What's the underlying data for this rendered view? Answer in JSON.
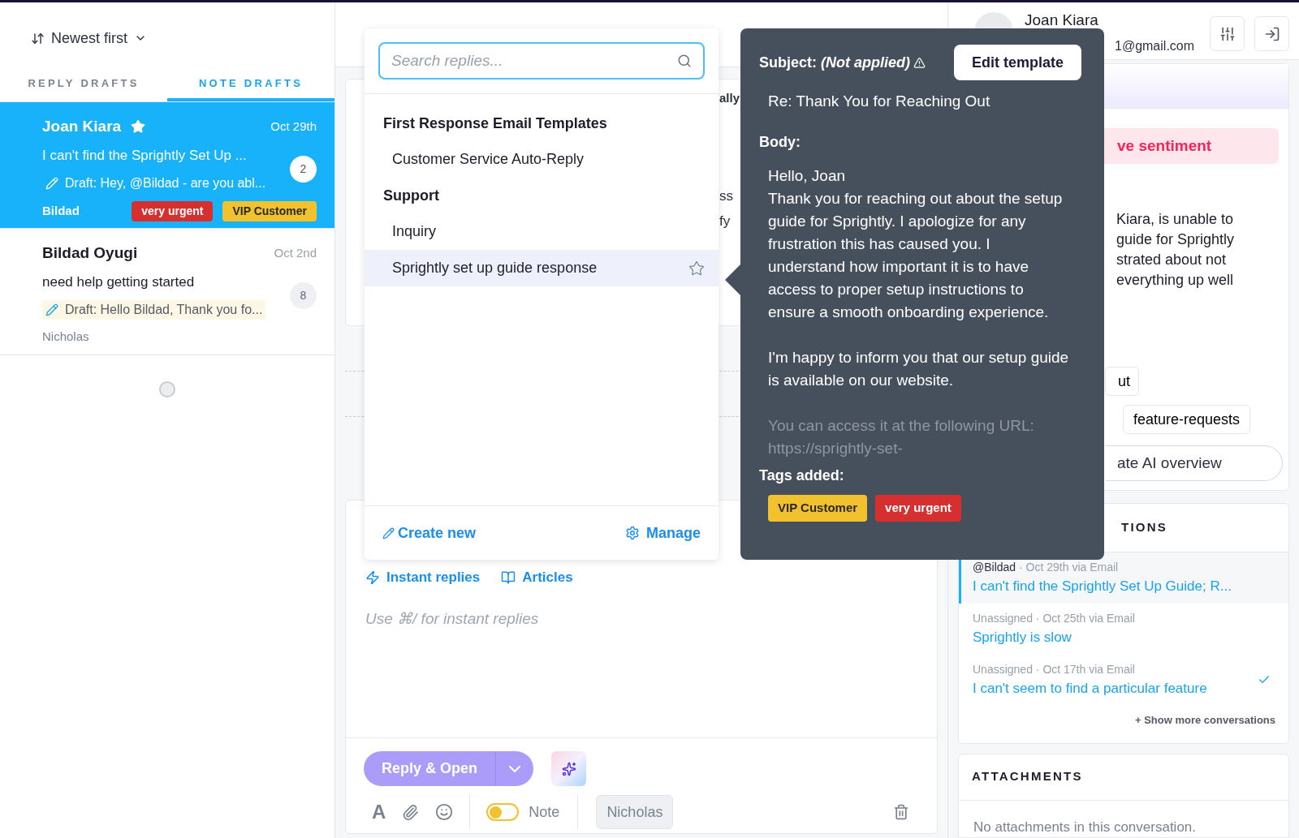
{
  "sort": {
    "label": "Newest first"
  },
  "draft_tabs": [
    {
      "label": "REPLY DRAFTS",
      "selected": false
    },
    {
      "label": "NOTE DRAFTS",
      "selected": true
    }
  ],
  "conversations": [
    {
      "name": "Joan Kiara",
      "starred": true,
      "date": "Oct 29th",
      "subject": "I can't find the Sprightly Set Up ...",
      "draft": "Draft: Hey, @Bildad - are you abl...",
      "count": "2",
      "assignee": "Bildad",
      "selected": true,
      "tags": [
        {
          "label": "very urgent",
          "color": "#d62f2f"
        },
        {
          "label": "VIP Customer",
          "color": "#f2c12e"
        }
      ]
    },
    {
      "name": "Bildad Oyugi",
      "starred": false,
      "date": "Oct 2nd",
      "subject": "need help getting started",
      "draft": "Draft: Hello Bildad, Thank you fo...",
      "count": "8",
      "assignee": "Nicholas",
      "selected": false
    }
  ],
  "thread_peek": [
    "ally",
    "ss",
    "fy"
  ],
  "composer": {
    "links": [
      {
        "kind": "bolt",
        "label": "Instant replies"
      },
      {
        "kind": "book",
        "label": "Articles"
      }
    ],
    "placeholder": "Use ⌘/ for instant replies",
    "send_button": "Reply & Open",
    "format_glyph": "A",
    "note_toggle": {
      "label": "Note",
      "on": false
    },
    "assignee": "Nicholas"
  },
  "replies_dropdown": {
    "placeholder": "Search replies...",
    "groups": [
      {
        "title": "First Response Email Templates",
        "items": [
          {
            "label": "Customer Service Auto-Reply",
            "selected": false,
            "starred": false
          }
        ]
      },
      {
        "title": "Support",
        "items": [
          {
            "label": "Inquiry",
            "selected": false,
            "starred": false
          },
          {
            "label": "Sprightly set up guide response",
            "selected": true,
            "starred": false
          }
        ]
      }
    ],
    "create_label": "Create new",
    "manage_label": "Manage"
  },
  "template_preview": {
    "subject_label": "Subject:",
    "subject_note": "(Not applied)",
    "edit_button": "Edit template",
    "subject": "Re: Thank You for Reaching Out",
    "body_label": "Body:",
    "body_paragraphs": [
      {
        "text": "Hello, Joan\nThank you for reaching out about the setup guide for Sprightly. I apologize for any frustration this has caused you. I understand how important it is to have access to proper setup instructions to ensure a smooth onboarding experience.",
        "faded": false
      },
      {
        "text": "I'm happy to inform you that our setup guide is available on our website.",
        "faded": false
      },
      {
        "text": "You can access it at the following URL:\nhttps://sprightly-set-",
        "faded": true
      }
    ],
    "tags_label": "Tags added:",
    "tags": [
      {
        "label": "VIP Customer",
        "color": "#f2c12e"
      },
      {
        "label": "very urgent",
        "color": "#d62f2f"
      }
    ]
  },
  "contact": {
    "name": "Joan Kiara",
    "email_fragment": "1@gmail.com",
    "sentiment_fragment": "ve sentiment",
    "summary_fragments": [
      "Kiara, is unable to",
      "guide for Sprightly",
      "strated about not",
      "everything up well"
    ],
    "topic_fragments": [
      "ut",
      "feature-requests"
    ],
    "ai_button_fragment": "ate AI overview"
  },
  "recent_conversations": {
    "heading_fragment": "TIONS",
    "items": [
      {
        "author": "@Bildad",
        "meta": "· Oct 29th via Email",
        "title": "I can't find the Sprightly Set Up Guide; R...",
        "selected": true,
        "resolved": false
      },
      {
        "author": "Unassigned",
        "meta": "· Oct 25th via Email",
        "title": "Sprightly is slow",
        "selected": false,
        "resolved": false
      },
      {
        "author": "Unassigned",
        "meta": "· Oct 17th via Email",
        "title": "I can't seem to find a particular feature",
        "selected": false,
        "resolved": true
      }
    ],
    "show_more": "+ Show more conversations"
  },
  "attachments": {
    "heading": "ATTACHMENTS",
    "empty": "No attachments in this conversation."
  }
}
